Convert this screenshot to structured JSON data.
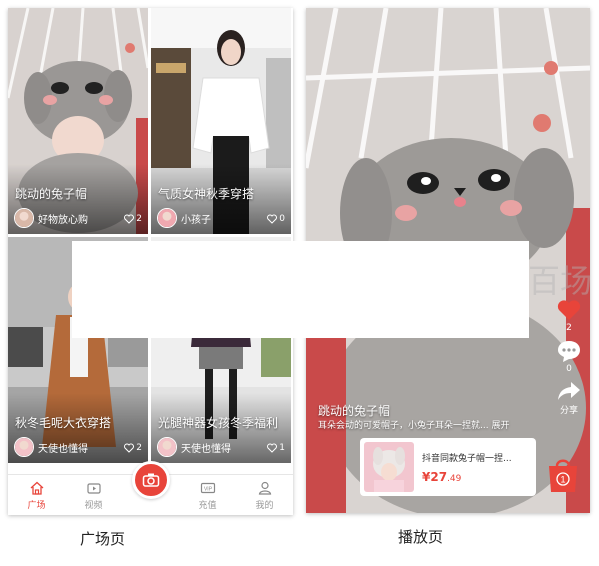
{
  "square": {
    "cards": [
      {
        "title": "跳动的兔子帽",
        "author": "好物放心购",
        "likes": "2"
      },
      {
        "title": "气质女神秋季穿搭",
        "author": "小孩子",
        "likes": "0"
      },
      {
        "title": "秋冬毛呢大衣穿搭",
        "author": "天使也懂得",
        "likes": "2"
      },
      {
        "title": "光腿神器女孩冬季福利",
        "author": "天使也懂得",
        "likes": "1"
      }
    ],
    "nav": {
      "square": "广场",
      "video": "视频",
      "vip_badge": "VIP",
      "recharge": "充值",
      "mine": "我的"
    },
    "caption": "广场页"
  },
  "play": {
    "like_count": "2",
    "comment_count": "0",
    "share_label": "分享",
    "video_title": "跳动的兔子帽",
    "video_desc": "耳朵会动的可爱帽子，小兔子耳朵一捏就... 展开",
    "product": {
      "name": "抖音同款兔子帽一捏...",
      "price_symbol": "¥",
      "price_int": "27",
      "price_dec": ".49"
    },
    "cart_badge": "1",
    "caption": "播放页"
  },
  "watermark": "百场",
  "colors": {
    "accent": "#e8443a"
  }
}
